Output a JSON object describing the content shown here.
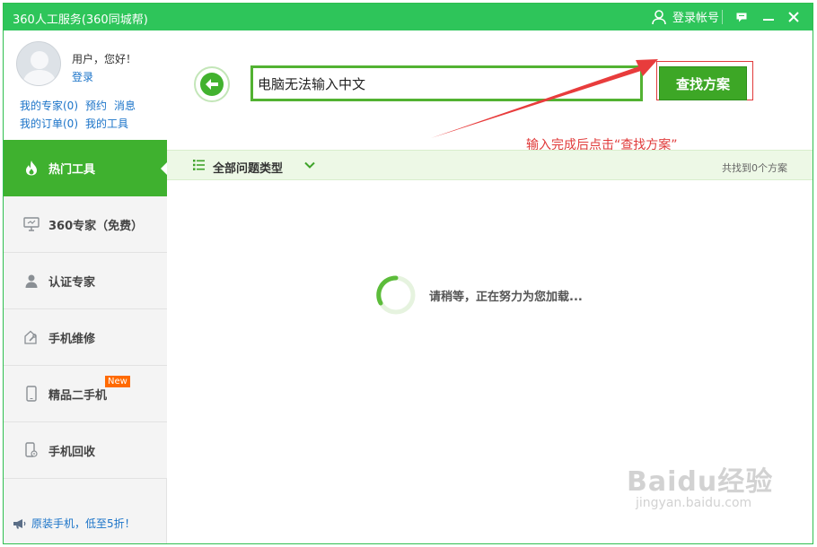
{
  "window": {
    "title": "360人工服务(360同城帮)",
    "login_label": "登录帐号"
  },
  "user": {
    "greeting": "用户，您好！",
    "login_link": "登录",
    "links_row1": [
      "我的专家(0)",
      "预约",
      "消息"
    ],
    "links_row2": [
      "我的订单(0)",
      "我的工具"
    ]
  },
  "nav": {
    "items": [
      {
        "label": "热门工具",
        "icon": "flame-icon",
        "active": true
      },
      {
        "label": "360专家（免费）",
        "icon": "monitor-expert-icon"
      },
      {
        "label": "认证专家",
        "icon": "person-icon"
      },
      {
        "label": "手机维修",
        "icon": "wrench-icon"
      },
      {
        "label": "精品二手机",
        "icon": "phone-icon",
        "badge": "New"
      },
      {
        "label": "手机回收",
        "icon": "phone-recycle-icon"
      }
    ],
    "promo": "原装手机，低至5折！"
  },
  "search": {
    "value": "电脑无法输入中文",
    "button_label": "查找方案"
  },
  "annotation": "输入完成后点击“查找方案”",
  "filter": {
    "label": "全部问题类型",
    "count": "共找到0个方案"
  },
  "loading_text": "请稍等，正在努力为您加载...",
  "watermark": {
    "logo": "Baidu经验",
    "url": "jingyan.baidu.com"
  },
  "colors": {
    "titlebar": "#2ec55a",
    "accent_green": "#3fb12f",
    "annotation_red": "#e03a3a",
    "link_blue": "#1a73c8"
  }
}
